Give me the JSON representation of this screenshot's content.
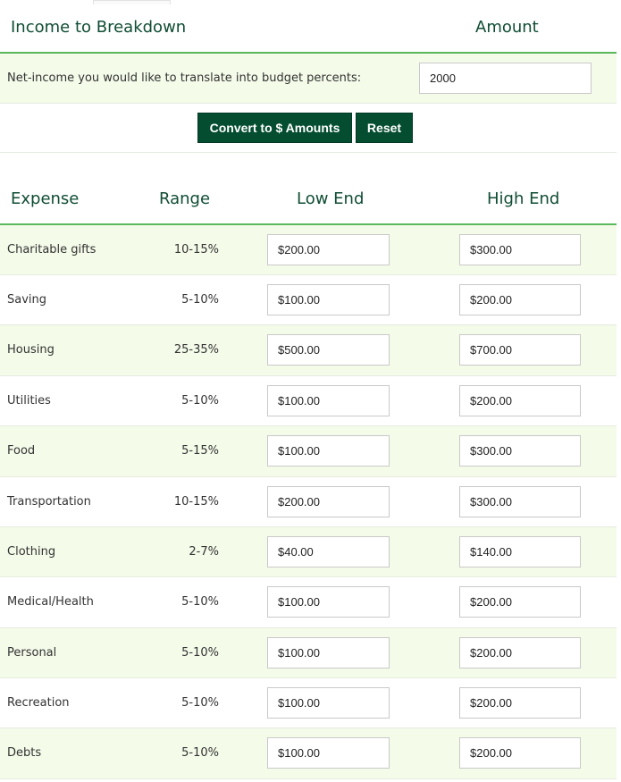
{
  "income_section": {
    "header_label": "Income to Breakdown",
    "amount_header": "Amount",
    "net_income_label": "Net-income you would like to translate into budget percents:",
    "net_income_value": "2000",
    "convert_button": "Convert to $ Amounts",
    "reset_button": "Reset"
  },
  "expense_table": {
    "headers": {
      "expense": "Expense",
      "range": "Range",
      "low": "Low End",
      "high": "High End"
    },
    "rows": [
      {
        "expense": "Charitable gifts",
        "range": "10-15%",
        "low": "$200.00",
        "high": "$300.00"
      },
      {
        "expense": "Saving",
        "range": "5-10%",
        "low": "$100.00",
        "high": "$200.00"
      },
      {
        "expense": "Housing",
        "range": "25-35%",
        "low": "$500.00",
        "high": "$700.00"
      },
      {
        "expense": "Utilities",
        "range": "5-10%",
        "low": "$100.00",
        "high": "$200.00"
      },
      {
        "expense": "Food",
        "range": "5-15%",
        "low": "$100.00",
        "high": "$300.00"
      },
      {
        "expense": "Transportation",
        "range": "10-15%",
        "low": "$200.00",
        "high": "$300.00"
      },
      {
        "expense": "Clothing",
        "range": "2-7%",
        "low": "$40.00",
        "high": "$140.00"
      },
      {
        "expense": "Medical/Health",
        "range": "5-10%",
        "low": "$100.00",
        "high": "$200.00"
      },
      {
        "expense": "Personal",
        "range": "5-10%",
        "low": "$100.00",
        "high": "$200.00"
      },
      {
        "expense": "Recreation",
        "range": "5-10%",
        "low": "$100.00",
        "high": "$200.00"
      },
      {
        "expense": "Debts",
        "range": "5-10%",
        "low": "$100.00",
        "high": "$200.00"
      }
    ]
  },
  "colors": {
    "header_text": "#0f4d33",
    "accent_line": "#5cb85c",
    "row_tint": "#f4fbe9",
    "button_bg": "#044d31"
  }
}
